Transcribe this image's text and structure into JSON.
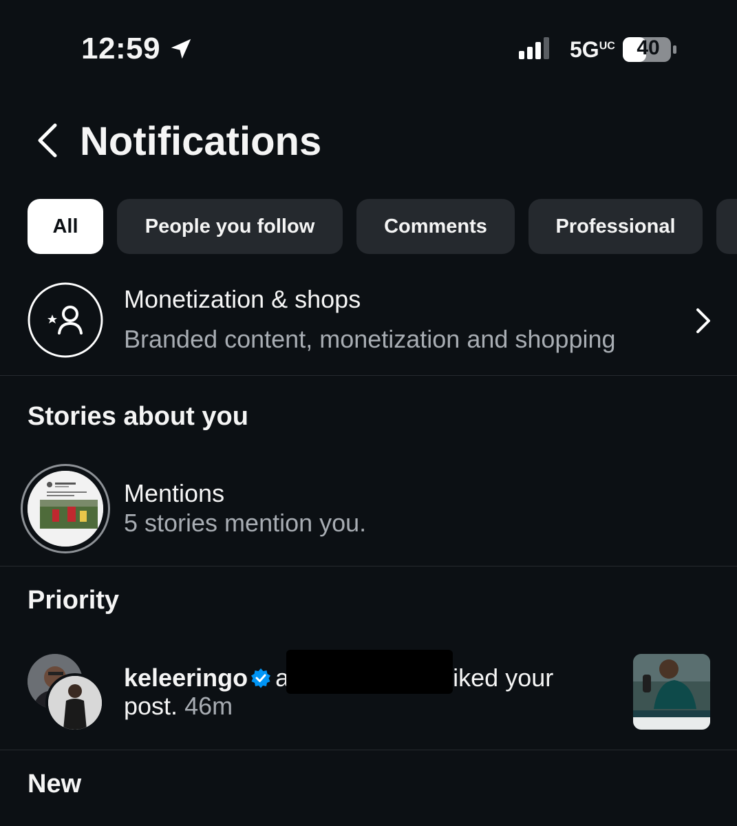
{
  "status_bar": {
    "time": "12:59",
    "network": "5G",
    "network_sup": "UC",
    "battery": "40"
  },
  "header": {
    "title": "Notifications"
  },
  "chips": [
    {
      "label": "All",
      "active": true
    },
    {
      "label": "People you follow"
    },
    {
      "label": "Comments"
    },
    {
      "label": "Professional"
    }
  ],
  "monetization": {
    "title": "Monetization & shops",
    "subtitle": "Branded content, monetization and shopping"
  },
  "stories_section": {
    "heading": "Stories about you"
  },
  "mentions": {
    "title": "Mentions",
    "subtitle": "5 stories mention you."
  },
  "priority": {
    "heading": "Priority",
    "notification": {
      "username": "keleeringo",
      "joiner": "and",
      "action": "liked your",
      "line2": "post.",
      "time": "46m"
    }
  },
  "new_section": {
    "heading": "New"
  },
  "colors": {
    "background": "#0c1014",
    "chip": "#25292e",
    "verified": "#0095f6",
    "muted": "#a8adb3"
  }
}
